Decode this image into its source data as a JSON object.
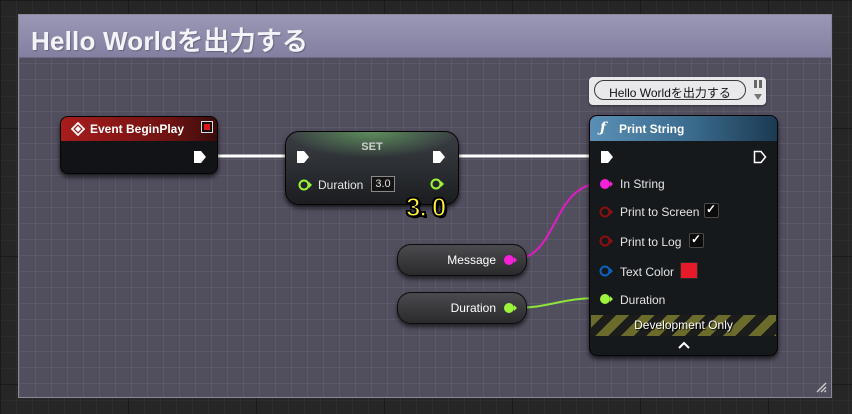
{
  "comment": {
    "title": "Hello Worldを出力する"
  },
  "event_node": {
    "title": "Event BeginPlay"
  },
  "set_node": {
    "title": "SET",
    "duration_label": "Duration",
    "duration_value": "3.0",
    "annotation": "3. 0"
  },
  "print_node": {
    "title": "Print String",
    "comment_bubble": "Hello Worldを出力する",
    "pins": {
      "in_string": "In String",
      "print_to_screen": "Print to Screen",
      "print_to_log": "Print to Log",
      "text_color": "Text Color",
      "duration": "Duration"
    },
    "print_to_screen_checked": true,
    "print_to_log_checked": true,
    "footer": "Development Only",
    "colors": {
      "text_color_swatch": "#e81a2a"
    }
  },
  "message_var": {
    "label": "Message"
  },
  "duration_var": {
    "label": "Duration"
  },
  "colors": {
    "exec_wire": "#ffffff",
    "string_pin": "#f81fd8",
    "float_pin": "#9cf53c",
    "bool_pin": "#8e0f0f",
    "struct_pin": "#0b62c0",
    "event_header": "#9c1a1a",
    "function_header": "#3e6e8f",
    "comment_header": "#8e8bab"
  },
  "icons": {
    "event": "diamond-icon",
    "function": "function-f-icon",
    "collapse": "chevron-up-icon",
    "delegate": "red-square-icon"
  }
}
